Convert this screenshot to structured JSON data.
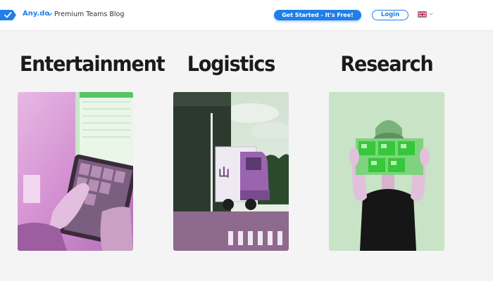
{
  "header": {
    "brand": "Any.do",
    "nav_text": "Premium Teams Blog",
    "cta_label": "Get Started - It's Free!",
    "login_label": "Login",
    "logo_icon": "checkmark-icon",
    "language_icon": "uk-flag-icon"
  },
  "cards": [
    {
      "title": "Entertainment",
      "image_icon": "tablet-photo"
    },
    {
      "title": "Logistics",
      "image_icon": "truck-photo"
    },
    {
      "title": "Research",
      "image_icon": "person-holding-paper-photo"
    }
  ],
  "colors": {
    "accent": "#1f7ee8",
    "background": "#f4f4f4",
    "header_bg": "#ffffff"
  }
}
